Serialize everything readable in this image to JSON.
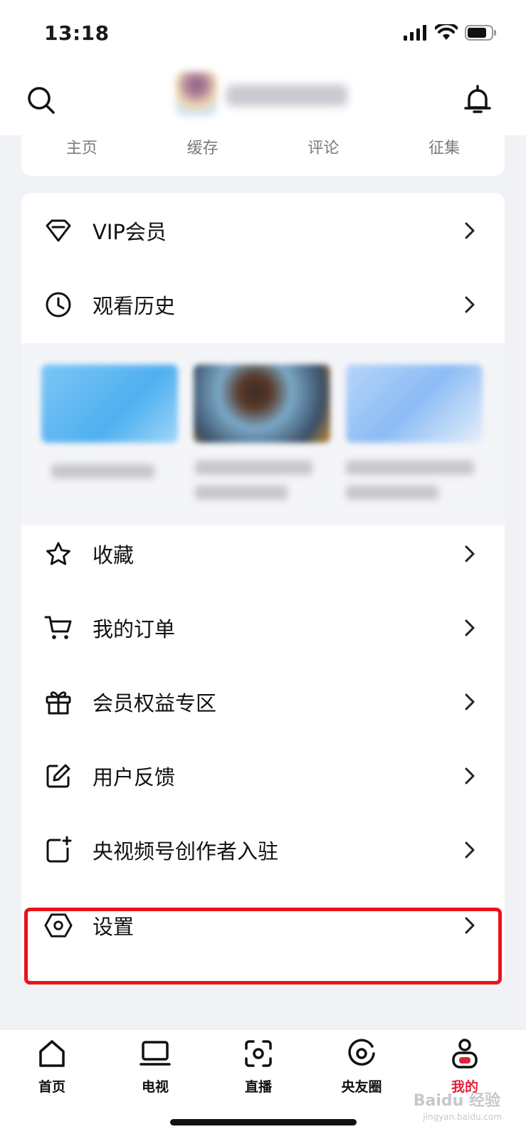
{
  "status_bar": {
    "time": "13:18"
  },
  "profile_tabs": [
    "主页",
    "缓存",
    "评论",
    "征集"
  ],
  "menu": {
    "vip": "VIP会员",
    "history": "观看历史",
    "favorites": "收藏",
    "orders": "我的订单",
    "benefits": "会员权益专区",
    "feedback": "用户反馈",
    "creator": "央视频号创作者入驻",
    "settings": "设置"
  },
  "tabbar": {
    "items": [
      {
        "label": "首页",
        "icon": "home-icon"
      },
      {
        "label": "电视",
        "icon": "tv-icon"
      },
      {
        "label": "直播",
        "icon": "live-icon"
      },
      {
        "label": "央友圈",
        "icon": "circle-icon"
      },
      {
        "label": "我的",
        "icon": "profile-icon"
      }
    ],
    "active_color": "#e4223b"
  },
  "highlight_color": "#e8141c",
  "watermark": {
    "brand": "Baidu 经验",
    "url": "jingyan.baidu.com"
  }
}
